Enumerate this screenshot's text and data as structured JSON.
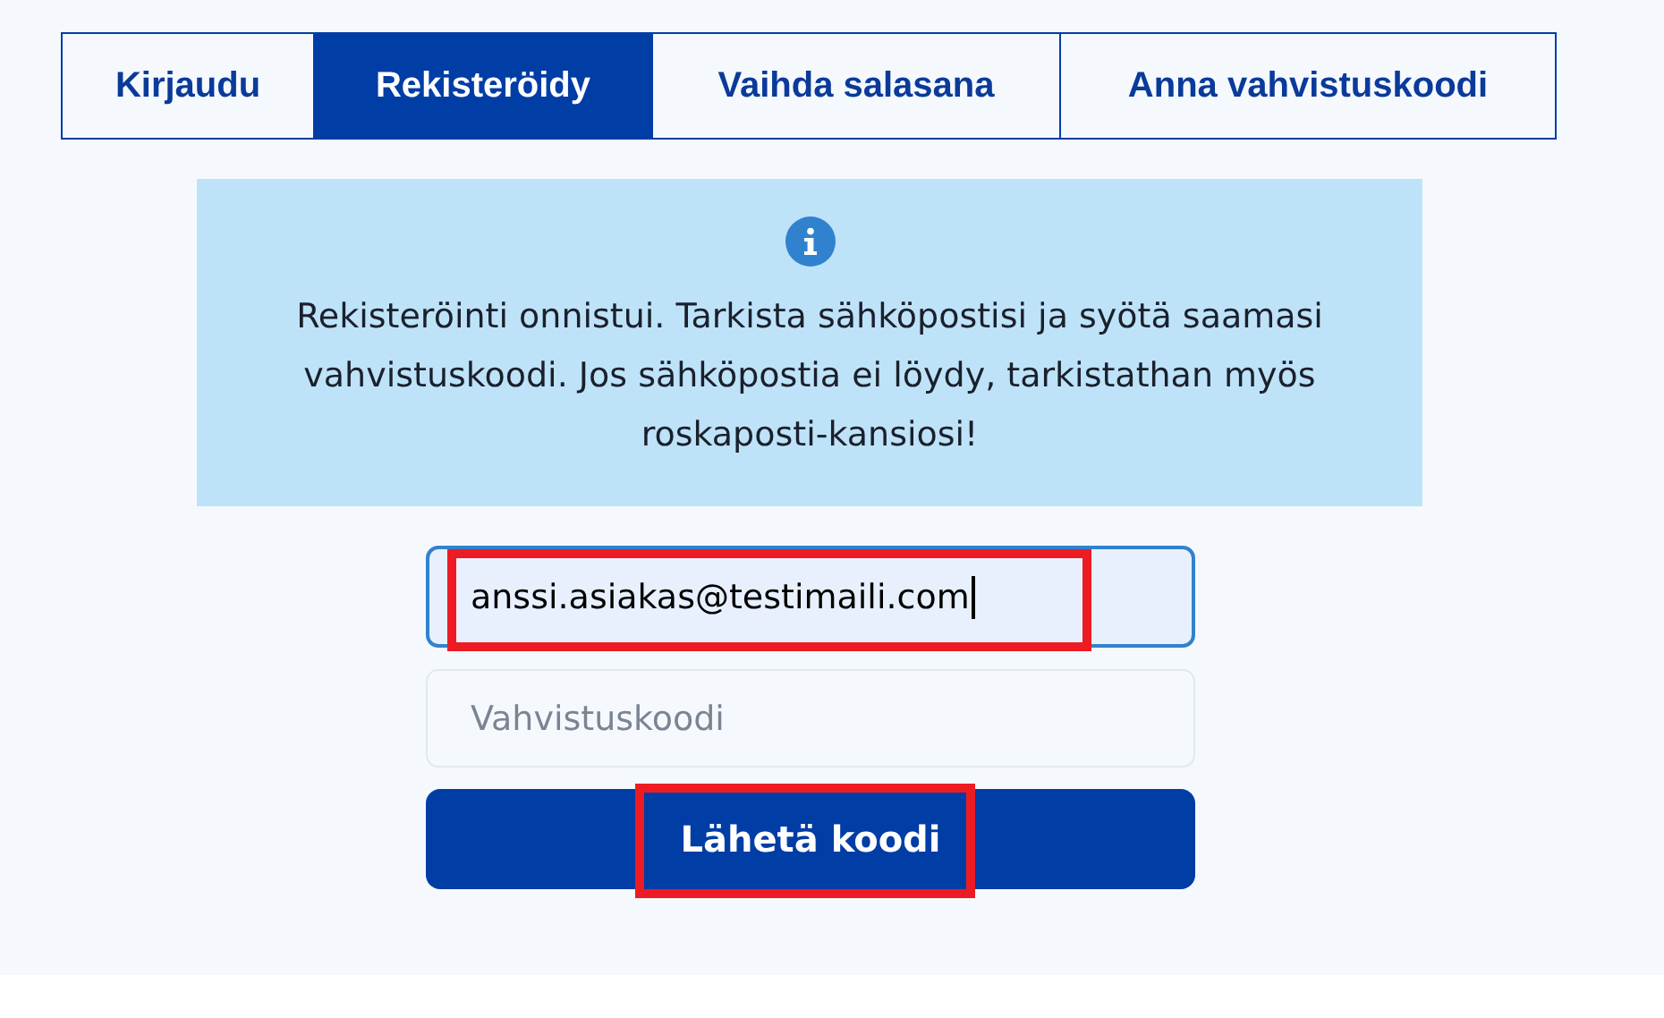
{
  "tabs": [
    {
      "label": "Kirjaudu",
      "selected": false
    },
    {
      "label": "Rekisteröidy",
      "selected": true
    },
    {
      "label": "Vaihda salasana",
      "selected": false
    },
    {
      "label": "Anna vahvistuskoodi",
      "selected": false
    }
  ],
  "notice": {
    "kind": "info",
    "text": "Rekisteröinti onnistui. Tarkista sähköpostisi ja syötä saamasi vahvistuskoodi. Jos sähköpostia ei löydy, tarkistathan myös roskaposti-kansiosi!"
  },
  "fields": [
    {
      "value": "anssi.asiakas@testimaili.com",
      "focused": true,
      "highlighted": true
    },
    {
      "placeholder": "Vahvistuskoodi",
      "focused": false,
      "highlighted": false
    }
  ],
  "submit": {
    "label": "Lähetä koodi",
    "highlighted": true
  }
}
